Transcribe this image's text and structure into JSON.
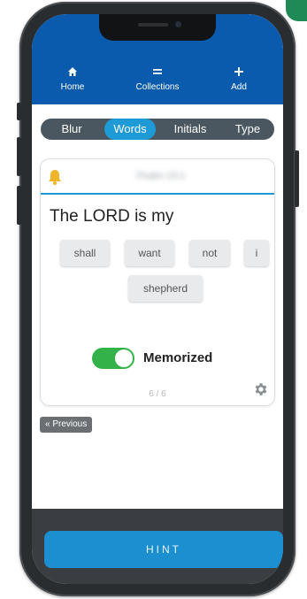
{
  "nav": {
    "home": {
      "icon": "home-icon",
      "glyph": "⌂",
      "label": "Home"
    },
    "collections": {
      "icon": "menu-icon",
      "glyph": "≡",
      "label": "Collections"
    },
    "add": {
      "icon": "plus-icon",
      "glyph": "+",
      "label": "Add"
    }
  },
  "modes": {
    "items": [
      "Blur",
      "Words",
      "Initials",
      "Type"
    ],
    "active": "Words"
  },
  "card": {
    "reference": "Psalm 23:1",
    "verse_text": "The LORD is my",
    "word_chips": [
      "shall",
      "want",
      "not",
      "i",
      "shepherd"
    ],
    "memorized_label": "Memorized",
    "memorized_on": true,
    "counter": "6 / 6"
  },
  "footer": {
    "previous_label": "« Previous",
    "hint_label": "HINT"
  },
  "colors": {
    "appbar": "#0a5bae",
    "accent": "#1e9ad6",
    "toggle_on": "#34b24a",
    "bell": "#f0b429"
  }
}
